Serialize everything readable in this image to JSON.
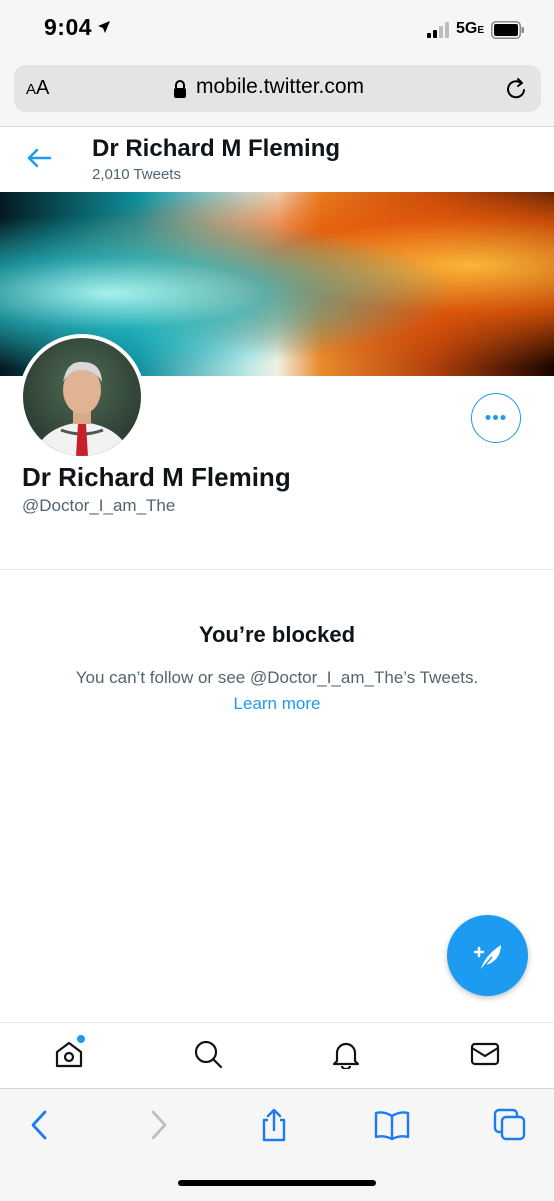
{
  "status_bar": {
    "time": "9:04",
    "network": "5G",
    "network_suffix": "E"
  },
  "address_bar": {
    "text_size_label": "AA",
    "url": "mobile.twitter.com"
  },
  "header": {
    "name": "Dr Richard M Fleming",
    "tweet_count": "2,010 Tweets"
  },
  "profile": {
    "name": "Dr Richard M Fleming",
    "handle": "@Doctor_I_am_The"
  },
  "blocked": {
    "title": "You’re blocked",
    "message": "You can’t follow or see @Doctor_I_am_The’s Tweets.",
    "link": "Learn more"
  },
  "colors": {
    "accent": "#1d9bf0",
    "secondary_text": "#536471"
  },
  "icons": {
    "bottom_nav": [
      "home-icon",
      "search-icon",
      "notifications-icon",
      "messages-icon"
    ],
    "toolbar": [
      "back-icon",
      "forward-icon",
      "share-icon",
      "bookmarks-icon",
      "tabs-icon"
    ]
  }
}
